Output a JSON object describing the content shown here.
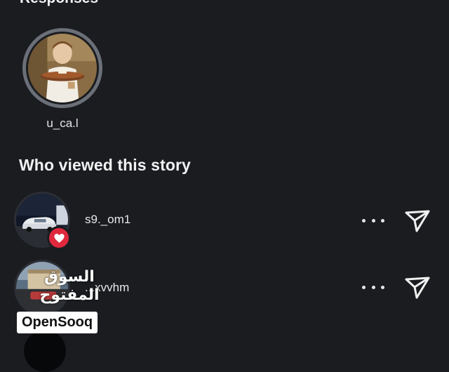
{
  "responses": {
    "heading": "Responses",
    "items": [
      {
        "username": "u_ca.l"
      }
    ]
  },
  "viewers": {
    "title": "Who viewed this story",
    "items": [
      {
        "username": "s9._om1",
        "liked": true,
        "more_icon": "more-dots-icon",
        "action_icon": "send-icon"
      },
      {
        "username": "...xvvhm",
        "liked": false,
        "more_icon": "more-dots-icon",
        "action_icon": "send-icon"
      }
    ]
  },
  "watermark": {
    "arabic": "السوق المفتوح",
    "brand": "OpenSooq"
  },
  "colors": {
    "background": "#1a1c20",
    "text": "#f2f2f2",
    "like_badge": "#e0293d",
    "avatar_ring": "#6b6f78"
  }
}
